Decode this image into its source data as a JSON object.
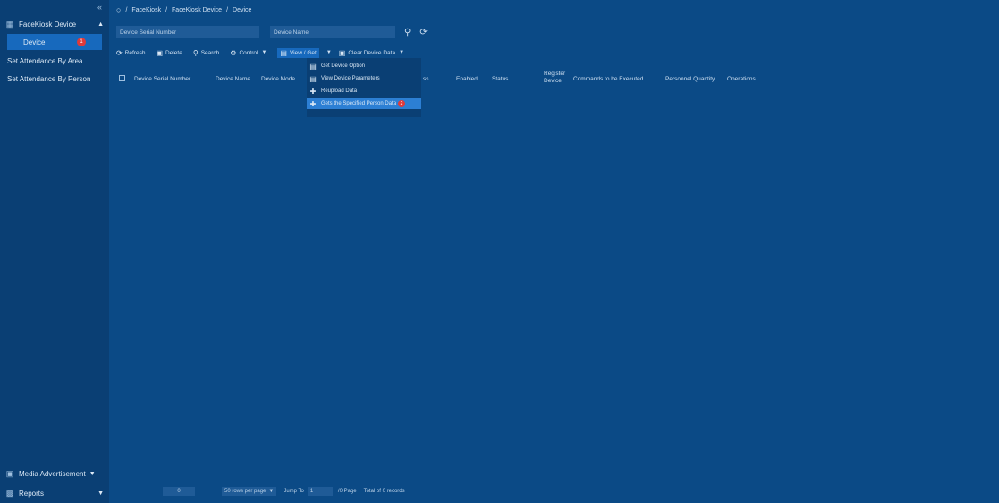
{
  "sidebar": {
    "collapse_icon": "collapse-arrow-icon",
    "group_label": "FaceKiosk Device",
    "items": [
      {
        "label": "Device",
        "badge": "1"
      },
      {
        "label": "Set Attendance By Area"
      },
      {
        "label": "Set Attendance By Person"
      }
    ],
    "bottom": [
      {
        "label": "Media Advertisement"
      },
      {
        "label": "Reports"
      }
    ]
  },
  "breadcrumb": {
    "home_icon": "home-icon",
    "sep": "/",
    "items": [
      "FaceKiosk",
      "FaceKiosk Device",
      "Device"
    ]
  },
  "search": {
    "serial_placeholder": "Device Serial Number",
    "name_placeholder": "Device Name"
  },
  "toolbar": {
    "refresh": "Refresh",
    "delete": "Delete",
    "search": "Search",
    "control": "Control",
    "view_get": "View / Get",
    "clear_device_data": "Clear Device Data"
  },
  "table": {
    "headers": [
      "Device Serial Number",
      "Device Name",
      "Device Mode",
      "ss",
      "Enabled",
      "Status",
      "Register",
      "Device",
      "Commands to be Executed",
      "Personnel Quantity",
      "Operations"
    ]
  },
  "dropdown": {
    "items": [
      {
        "label": "Get Device Option"
      },
      {
        "label": "View Device Parameters"
      },
      {
        "label": "Reupload Data"
      },
      {
        "label": "Gets the Specified Person Data",
        "badge": "2"
      }
    ]
  },
  "pager": {
    "page": "0",
    "rows_per_page": "50 rows per page",
    "jump_to": "Jump To",
    "jump_value": "1",
    "of_page": "/0 Page",
    "total": "Total of 0 records"
  },
  "colors": {
    "background": "#0b4a86",
    "sidebar": "#0a3f74",
    "accent": "#1769bd",
    "badge": "#e03a3a"
  }
}
